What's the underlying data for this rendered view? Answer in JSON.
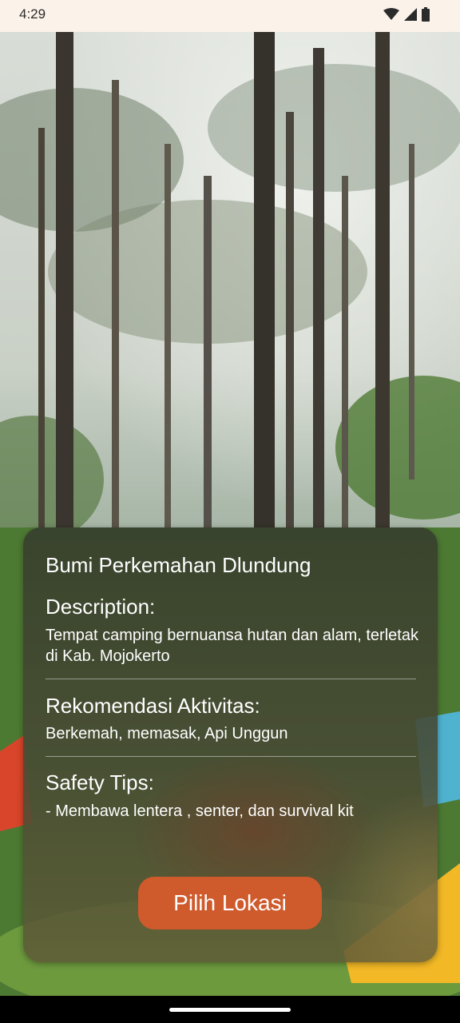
{
  "status_bar": {
    "time": "4:29",
    "icons": [
      "wifi-icon",
      "cellular-signal-icon",
      "battery-icon"
    ]
  },
  "background": {
    "description_icon": "forest-campsite-photo"
  },
  "card": {
    "title": "Bumi Perkemahan Dlundung",
    "description_heading": "Description:",
    "description_text": "Tempat camping bernuansa hutan dan alam, terletak di Kab. Mojokerto",
    "activities_heading": "Rekomendasi Aktivitas:",
    "activities_text": "Berkemah, memasak, Api Unggun",
    "safety_heading": "Safety Tips:",
    "safety_text": "- Membawa lentera , senter, dan survival kit",
    "button_label": "Pilih Lokasi"
  },
  "colors": {
    "button": "#cf5a2c",
    "status_bar_bg": "#fbf3ea"
  }
}
